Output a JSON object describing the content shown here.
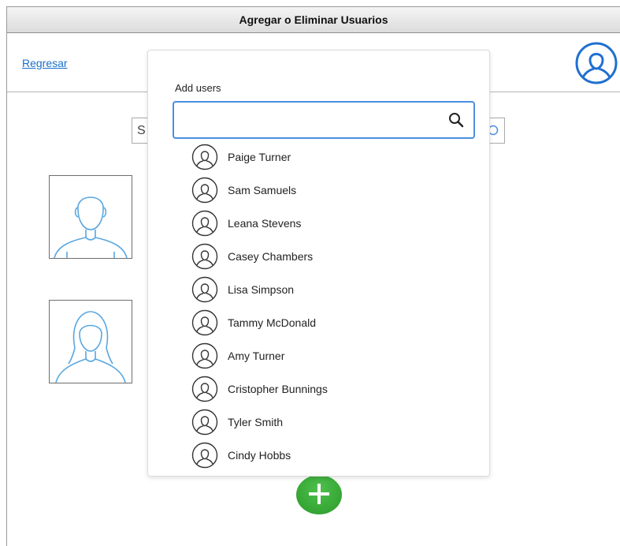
{
  "window": {
    "title": "Agregar o Eliminar Usuarios"
  },
  "header": {
    "back_label": "Regresar"
  },
  "background_search": {
    "value": "S"
  },
  "modal": {
    "title": "Add users",
    "search_value": "",
    "users": [
      {
        "name": "Paige Turner"
      },
      {
        "name": "Sam Samuels"
      },
      {
        "name": "Leana Stevens"
      },
      {
        "name": "Casey Chambers"
      },
      {
        "name": "Lisa Simpson"
      },
      {
        "name": "Tammy McDonald"
      },
      {
        "name": "Amy Turner"
      },
      {
        "name": "Cristopher Bunnings"
      },
      {
        "name": "Tyler Smith"
      },
      {
        "name": "Cindy Hobbs"
      }
    ]
  },
  "icons": {
    "account": "user-circle-icon",
    "search": "search-icon",
    "add": "plus-icon"
  },
  "colors": {
    "link": "#1a6fc9",
    "accent": "#1f6fd0",
    "search_focus": "#4a8fe0",
    "add_button": "#2a9a2b"
  }
}
